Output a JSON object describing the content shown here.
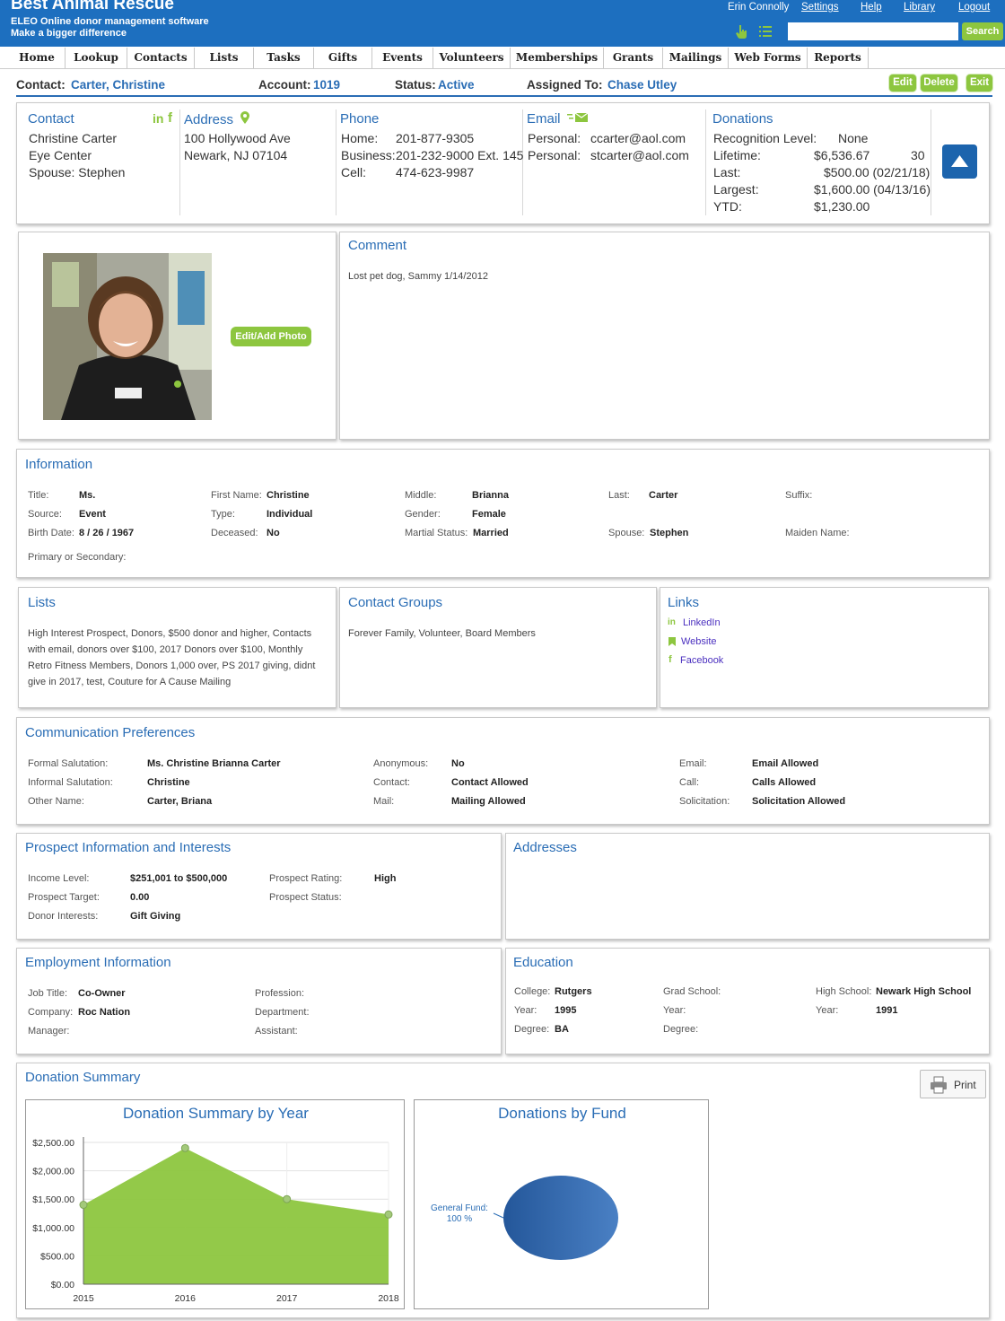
{
  "header": {
    "org_name": "Best Animal Rescue",
    "tagline1": "ELEO Online donor management software",
    "tagline2": "Make a bigger difference",
    "user": "Erin Connolly",
    "links": [
      "Settings",
      "Help",
      "Library",
      "Logout"
    ],
    "search_placeholder": "",
    "search_label": "Search"
  },
  "nav": [
    "Home",
    "Lookup",
    "Contacts",
    "Lists",
    "Tasks",
    "Gifts",
    "Events",
    "Volunteers",
    "Memberships",
    "Grants",
    "Mailings",
    "Web Forms",
    "Reports"
  ],
  "contact_bar": {
    "contact_label": "Contact:",
    "contact_value": "Carter, Christine",
    "account_label": "Account:",
    "account_value": "1019",
    "status_label": "Status:",
    "status_value": "Active",
    "assigned_label": "Assigned To:",
    "assigned_value": "Chase Utley",
    "buttons": [
      "Edit",
      "Delete",
      "Exit"
    ]
  },
  "summary": {
    "contact": {
      "title": "Contact",
      "name": "Christine Carter",
      "company": "Eye Center",
      "spouse": "Spouse: Stephen"
    },
    "address": {
      "title": "Address",
      "line1": "100 Hollywood Ave",
      "line2": "Newark, NJ 07104"
    },
    "phone": {
      "title": "Phone",
      "rows": [
        {
          "label": "Home:",
          "value": "201-877-9305"
        },
        {
          "label": "Business:",
          "value": "201-232-9000 Ext. 145"
        },
        {
          "label": "Cell:",
          "value": "474-623-9987"
        }
      ]
    },
    "email": {
      "title": "Email",
      "rows": [
        {
          "label": "Personal:",
          "value": "ccarter@aol.com"
        },
        {
          "label": "Personal:",
          "value": "stcarter@aol.com"
        }
      ]
    },
    "donations": {
      "title": "Donations",
      "recognition_label": "Recognition Level:",
      "recognition_value": "None",
      "lifetime_label": "Lifetime:",
      "lifetime_value": "$6,536.67",
      "lifetime_count": "30",
      "last_label": "Last:",
      "last_value": "$500.00 (02/21/18)",
      "largest_label": "Largest:",
      "largest_value": "$1,600.00 (04/13/16)",
      "ytd_label": "YTD:",
      "ytd_value": "$1,230.00"
    }
  },
  "photo": {
    "button": "Edit/Add Photo"
  },
  "comment": {
    "title": "Comment",
    "text": "Lost pet dog, Sammy 1/14/2012"
  },
  "information": {
    "title": "Information",
    "title_label": "Title:",
    "title_value": "Ms.",
    "first_label": "First Name:",
    "first_value": "Christine",
    "middle_label": "Middle:",
    "middle_value": "Brianna",
    "last_label": "Last:",
    "last_value": "Carter",
    "suffix_label": "Suffix:",
    "source_label": "Source:",
    "source_value": "Event",
    "type_label": "Type:",
    "type_value": "Individual",
    "gender_label": "Gender:",
    "gender_value": "Female",
    "birth_label": "Birth Date:",
    "birth_value": "8 / 26 / 1967",
    "deceased_label": "Deceased:",
    "deceased_value": "No",
    "marital_label": "Martial Status:",
    "marital_value": "Married",
    "spouse_label": "Spouse:",
    "spouse_value": "Stephen",
    "maiden_label": "Maiden Name:",
    "primary_label": "Primary or Secondary:"
  },
  "lists": {
    "title": "Lists",
    "text": "High Interest Prospect, Donors, $500 donor and higher, Contacts with email, donors over $100, 2017 Donors over $100, Monthly Retro Fitness Members, Donors 1,000 over, PS 2017 giving, didnt give in 2017, test, Couture for A Cause Mailing"
  },
  "contact_groups": {
    "title": "Contact Groups",
    "text": "Forever Family, Volunteer, Board Members"
  },
  "links": {
    "title": "Links",
    "items": [
      "LinkedIn",
      "Website",
      "Facebook"
    ]
  },
  "communication": {
    "title": "Communication Preferences",
    "formal_label": "Formal Salutation:",
    "formal_value": "Ms. Christine Brianna Carter",
    "informal_label": "Informal Salutation:",
    "informal_value": "Christine",
    "other_label": "Other Name:",
    "other_value": "Carter, Briana",
    "anon_label": "Anonymous:",
    "anon_value": "No",
    "contact_label": "Contact:",
    "contact_value": "Contact Allowed",
    "mail_label": "Mail:",
    "mail_value": "Mailing Allowed",
    "email_label": "Email:",
    "email_value": "Email Allowed",
    "call_label": "Call:",
    "call_value": "Calls Allowed",
    "solicit_label": "Solicitation:",
    "solicit_value": "Solicitation Allowed"
  },
  "prospect": {
    "title": "Prospect Information and Interests",
    "income_label": "Income Level:",
    "income_value": "$251,001 to $500,000",
    "target_label": "Prospect Target:",
    "target_value": "0.00",
    "interests_label": "Donor Interests:",
    "interests_value": "Gift Giving",
    "rating_label": "Prospect Rating:",
    "rating_value": "High",
    "status_label": "Prospect Status:"
  },
  "addresses": {
    "title": "Addresses"
  },
  "employment": {
    "title": "Employment Information",
    "job_label": "Job Title:",
    "job_value": "Co-Owner",
    "company_label": "Company:",
    "company_value": "Roc Nation",
    "manager_label": "Manager:",
    "profession_label": "Profession:",
    "department_label": "Department:",
    "assistant_label": "Assistant:"
  },
  "education": {
    "title": "Education",
    "college_label": "College:",
    "college_value": "Rutgers",
    "year_label": "Year:",
    "college_year": "1995",
    "degree_label": "Degree:",
    "college_degree": "BA",
    "grad_label": "Grad School:",
    "hs_label": "High School:",
    "hs_value": "Newark High School",
    "hs_year": "1991"
  },
  "donation_summary": {
    "title": "Donation Summary",
    "print_label": "Print"
  },
  "chart_data": [
    {
      "type": "area",
      "title": "Donation Summary by Year",
      "x": [
        "2015",
        "2016",
        "2017",
        "2018"
      ],
      "values": [
        1400,
        2400,
        1500,
        1230
      ],
      "ylim": [
        0,
        2500
      ],
      "yticks": [
        "$0.00",
        "$500.00",
        "$1,000.00",
        "$1,500.00",
        "$2,000.00",
        "$2,500.00"
      ],
      "color": "#8dc63f",
      "grid": true
    },
    {
      "type": "pie",
      "title": "Donations by Fund",
      "slices": [
        {
          "label": "General Fund:",
          "percent_label": "100 %",
          "value": 100
        }
      ],
      "color": "#2f65a8"
    }
  ]
}
